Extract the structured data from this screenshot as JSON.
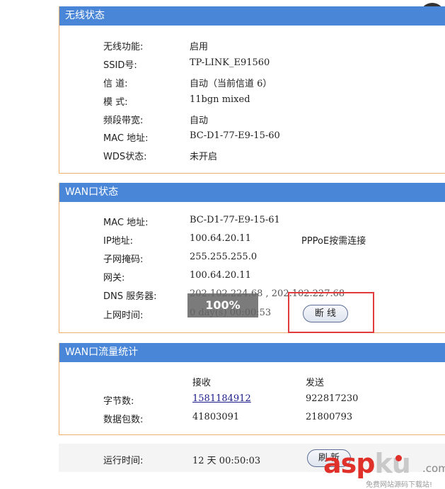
{
  "wireless": {
    "title": "无线状态",
    "rows": [
      {
        "label": "无线功能:",
        "value": "启用"
      },
      {
        "label": "SSID号:",
        "value": "TP-LINK_E91560"
      },
      {
        "label": "信 道:",
        "value": "自动（当前信道 6）"
      },
      {
        "label": "模 式:",
        "value": "11bgn mixed"
      },
      {
        "label": "频段带宽:",
        "value": "自动"
      },
      {
        "label": "MAC 地址:",
        "value": "BC-D1-77-E9-15-60"
      },
      {
        "label": "WDS状态:",
        "value": "未开启"
      }
    ]
  },
  "wan": {
    "title": "WAN口状态",
    "mac_label": "MAC 地址:",
    "mac_value": "BC-D1-77-E9-15-61",
    "ip_label": "IP地址:",
    "ip_value": "100.64.20.11",
    "ip_mode": "PPPoE按需连接",
    "mask_label": "子网掩码:",
    "mask_value": "255.255.255.0",
    "gateway_label": "网关:",
    "gateway_value": "100.64.20.11",
    "dns_label": "DNS 服务器:",
    "dns_value": "202.102.224.68 , 202.102.227.68",
    "online_label": "上网时间:",
    "online_value": "0 day(s) 00:00:53",
    "disconnect_label": "断 线",
    "progress_label": "100%",
    "progress_fraction": 1.0
  },
  "traffic": {
    "title": "WAN口流量统计",
    "col_recv": "接收",
    "col_send": "发送",
    "bytes_label": "字节数:",
    "bytes_recv": "1581184912",
    "bytes_send": "922817230",
    "packets_label": "数据包数:",
    "packets_recv": "41803091",
    "packets_send": "21800793"
  },
  "uptime": {
    "label": "运行时间:",
    "value": "12 天 00:50:03",
    "refresh_label": "刷 新"
  },
  "overlay": {
    "close_symbol": "✕"
  },
  "watermark": {
    "asp": "asp",
    "ku": "ku",
    "com": ".com",
    "tagline": "免费网站源码下载站!"
  },
  "colors": {
    "header_blue": "#4a86d8",
    "panel_border": "#f0b070",
    "highlight_red": "#e23b3b"
  }
}
